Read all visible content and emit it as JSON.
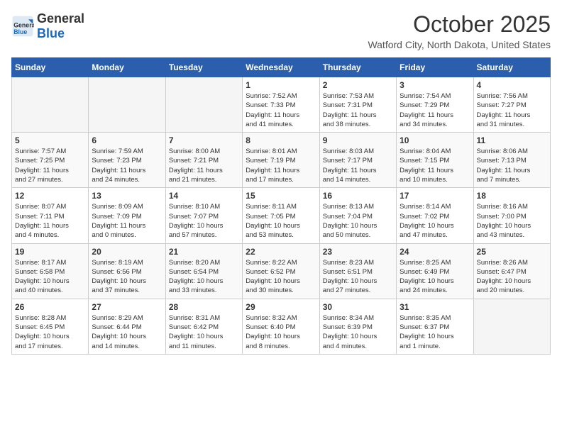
{
  "logo": {
    "general": "General",
    "blue": "Blue"
  },
  "title": "October 2025",
  "subtitle": "Watford City, North Dakota, United States",
  "days_of_week": [
    "Sunday",
    "Monday",
    "Tuesday",
    "Wednesday",
    "Thursday",
    "Friday",
    "Saturday"
  ],
  "weeks": [
    [
      {
        "day": "",
        "info": ""
      },
      {
        "day": "",
        "info": ""
      },
      {
        "day": "",
        "info": ""
      },
      {
        "day": "1",
        "info": "Sunrise: 7:52 AM\nSunset: 7:33 PM\nDaylight: 11 hours\nand 41 minutes."
      },
      {
        "day": "2",
        "info": "Sunrise: 7:53 AM\nSunset: 7:31 PM\nDaylight: 11 hours\nand 38 minutes."
      },
      {
        "day": "3",
        "info": "Sunrise: 7:54 AM\nSunset: 7:29 PM\nDaylight: 11 hours\nand 34 minutes."
      },
      {
        "day": "4",
        "info": "Sunrise: 7:56 AM\nSunset: 7:27 PM\nDaylight: 11 hours\nand 31 minutes."
      }
    ],
    [
      {
        "day": "5",
        "info": "Sunrise: 7:57 AM\nSunset: 7:25 PM\nDaylight: 11 hours\nand 27 minutes."
      },
      {
        "day": "6",
        "info": "Sunrise: 7:59 AM\nSunset: 7:23 PM\nDaylight: 11 hours\nand 24 minutes."
      },
      {
        "day": "7",
        "info": "Sunrise: 8:00 AM\nSunset: 7:21 PM\nDaylight: 11 hours\nand 21 minutes."
      },
      {
        "day": "8",
        "info": "Sunrise: 8:01 AM\nSunset: 7:19 PM\nDaylight: 11 hours\nand 17 minutes."
      },
      {
        "day": "9",
        "info": "Sunrise: 8:03 AM\nSunset: 7:17 PM\nDaylight: 11 hours\nand 14 minutes."
      },
      {
        "day": "10",
        "info": "Sunrise: 8:04 AM\nSunset: 7:15 PM\nDaylight: 11 hours\nand 10 minutes."
      },
      {
        "day": "11",
        "info": "Sunrise: 8:06 AM\nSunset: 7:13 PM\nDaylight: 11 hours\nand 7 minutes."
      }
    ],
    [
      {
        "day": "12",
        "info": "Sunrise: 8:07 AM\nSunset: 7:11 PM\nDaylight: 11 hours\nand 4 minutes."
      },
      {
        "day": "13",
        "info": "Sunrise: 8:09 AM\nSunset: 7:09 PM\nDaylight: 11 hours\nand 0 minutes."
      },
      {
        "day": "14",
        "info": "Sunrise: 8:10 AM\nSunset: 7:07 PM\nDaylight: 10 hours\nand 57 minutes."
      },
      {
        "day": "15",
        "info": "Sunrise: 8:11 AM\nSunset: 7:05 PM\nDaylight: 10 hours\nand 53 minutes."
      },
      {
        "day": "16",
        "info": "Sunrise: 8:13 AM\nSunset: 7:04 PM\nDaylight: 10 hours\nand 50 minutes."
      },
      {
        "day": "17",
        "info": "Sunrise: 8:14 AM\nSunset: 7:02 PM\nDaylight: 10 hours\nand 47 minutes."
      },
      {
        "day": "18",
        "info": "Sunrise: 8:16 AM\nSunset: 7:00 PM\nDaylight: 10 hours\nand 43 minutes."
      }
    ],
    [
      {
        "day": "19",
        "info": "Sunrise: 8:17 AM\nSunset: 6:58 PM\nDaylight: 10 hours\nand 40 minutes."
      },
      {
        "day": "20",
        "info": "Sunrise: 8:19 AM\nSunset: 6:56 PM\nDaylight: 10 hours\nand 37 minutes."
      },
      {
        "day": "21",
        "info": "Sunrise: 8:20 AM\nSunset: 6:54 PM\nDaylight: 10 hours\nand 33 minutes."
      },
      {
        "day": "22",
        "info": "Sunrise: 8:22 AM\nSunset: 6:52 PM\nDaylight: 10 hours\nand 30 minutes."
      },
      {
        "day": "23",
        "info": "Sunrise: 8:23 AM\nSunset: 6:51 PM\nDaylight: 10 hours\nand 27 minutes."
      },
      {
        "day": "24",
        "info": "Sunrise: 8:25 AM\nSunset: 6:49 PM\nDaylight: 10 hours\nand 24 minutes."
      },
      {
        "day": "25",
        "info": "Sunrise: 8:26 AM\nSunset: 6:47 PM\nDaylight: 10 hours\nand 20 minutes."
      }
    ],
    [
      {
        "day": "26",
        "info": "Sunrise: 8:28 AM\nSunset: 6:45 PM\nDaylight: 10 hours\nand 17 minutes."
      },
      {
        "day": "27",
        "info": "Sunrise: 8:29 AM\nSunset: 6:44 PM\nDaylight: 10 hours\nand 14 minutes."
      },
      {
        "day": "28",
        "info": "Sunrise: 8:31 AM\nSunset: 6:42 PM\nDaylight: 10 hours\nand 11 minutes."
      },
      {
        "day": "29",
        "info": "Sunrise: 8:32 AM\nSunset: 6:40 PM\nDaylight: 10 hours\nand 8 minutes."
      },
      {
        "day": "30",
        "info": "Sunrise: 8:34 AM\nSunset: 6:39 PM\nDaylight: 10 hours\nand 4 minutes."
      },
      {
        "day": "31",
        "info": "Sunrise: 8:35 AM\nSunset: 6:37 PM\nDaylight: 10 hours\nand 1 minute."
      },
      {
        "day": "",
        "info": ""
      }
    ]
  ]
}
